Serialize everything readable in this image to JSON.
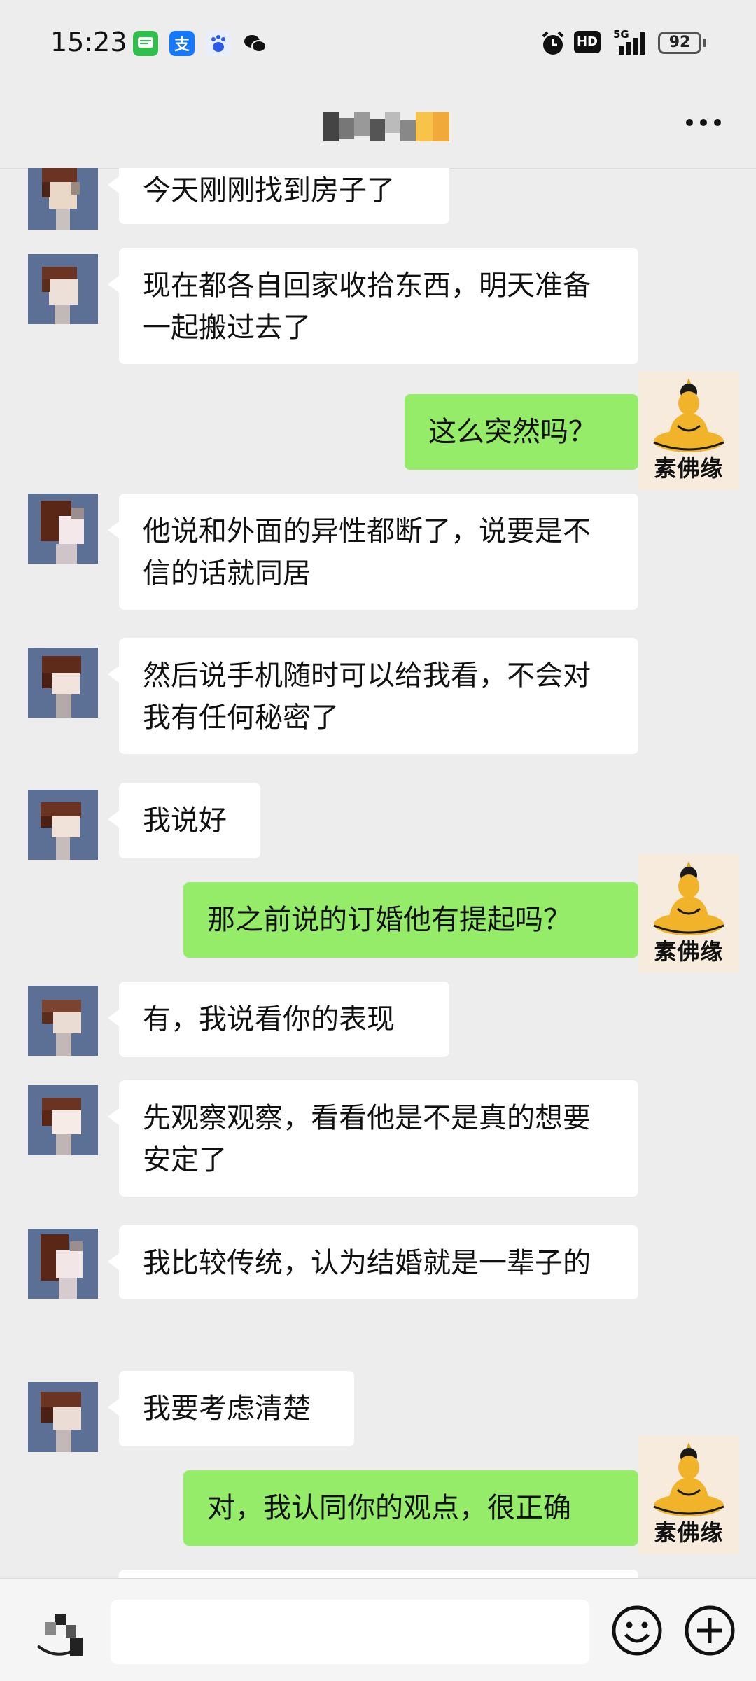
{
  "status": {
    "time": "15:23",
    "battery": "92",
    "network": "5G",
    "hd": "HD"
  },
  "colors": {
    "page_bg": "#ededed",
    "bubble_in": "#ffffff",
    "bubble_out": "#95ec69",
    "my_avatar_bg": "#f6ebdc"
  },
  "status_icons": [
    "messages-app-icon",
    "alipay-icon",
    "baidu-icon",
    "wechat-icon",
    "alarm-icon",
    "hd-icon",
    "signal-5g-icon",
    "battery-icon"
  ],
  "my_avatar_name": "素佛缘",
  "messages": [
    {
      "side": "left",
      "text": "今天刚刚找到房子了"
    },
    {
      "side": "left",
      "text": "现在都各自回家收拾东西，明天准备一起搬过去了"
    },
    {
      "side": "right",
      "text": "这么突然吗？"
    },
    {
      "side": "left",
      "text": "他说和外面的异性都断了，说要是不信的话就同居"
    },
    {
      "side": "left",
      "text": "然后说手机随时可以给我看，不会对我有任何秘密了"
    },
    {
      "side": "left",
      "text": "我说好"
    },
    {
      "side": "right",
      "text": "那之前说的订婚他有提起吗？"
    },
    {
      "side": "left",
      "text": "有，我说看你的表现"
    },
    {
      "side": "left",
      "text": "先观察观察，看看他是不是真的想要安定了"
    },
    {
      "side": "left",
      "text": "我比较传统，认为结婚就是一辈子的"
    },
    {
      "side": "left",
      "text": "我要考虑清楚"
    },
    {
      "side": "right",
      "text": "对，我认同你的观点，很正确"
    }
  ]
}
